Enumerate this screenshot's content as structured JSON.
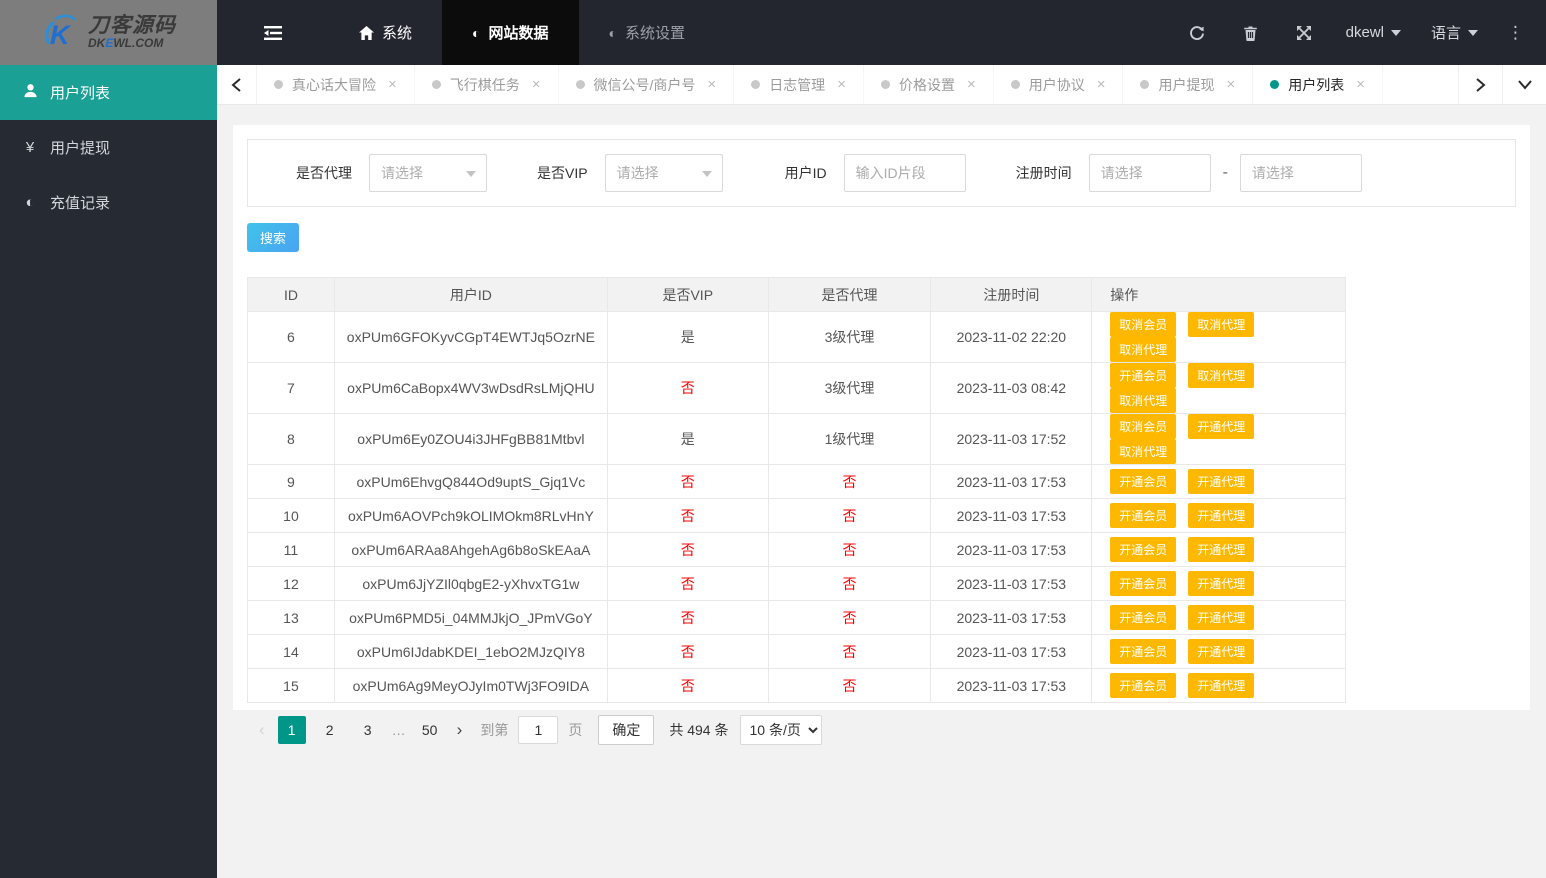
{
  "colors": {
    "accent_teal": "#1aa094",
    "accent_teal_dark": "#009688",
    "action_orange": "#ffb800",
    "negative_red": "#ff0000",
    "search_gradient_start": "#41c3e9",
    "search_gradient_end": "#4aa3f3",
    "header_dark": "#23262e",
    "nav_active_black": "#0c0c0c",
    "sidebar_dark": "#262b33",
    "logo_gray": "#7d7d7d"
  },
  "header": {
    "logo_title": "刀客源码",
    "logo_subtitle_pre": "DK",
    "logo_subtitle_mid": "E",
    "logo_subtitle_post": "WL.COM",
    "nav": [
      {
        "label": "系统",
        "icon": "home-icon",
        "active": false
      },
      {
        "label": "网站数据",
        "icon": "half-circle-icon",
        "active": true
      },
      {
        "label": "系统设置",
        "icon": "half-circle-icon",
        "active": false
      }
    ],
    "username": "dkewl",
    "language": "语言"
  },
  "sidebar": {
    "items": [
      {
        "label": "用户列表",
        "icon": "user-icon",
        "active": true
      },
      {
        "label": "用户提现",
        "icon": "yen-icon",
        "active": false
      },
      {
        "label": "充值记录",
        "icon": "half-circle-icon",
        "active": false
      }
    ]
  },
  "tabs": [
    {
      "label": "真心话大冒险",
      "active": false
    },
    {
      "label": "飞行棋任务",
      "active": false
    },
    {
      "label": "微信公号/商户号",
      "active": false
    },
    {
      "label": "日志管理",
      "active": false
    },
    {
      "label": "价格设置",
      "active": false
    },
    {
      "label": "用户协议",
      "active": false
    },
    {
      "label": "用户提现",
      "active": false
    },
    {
      "label": "用户列表",
      "active": true
    }
  ],
  "filters": {
    "agent_label": "是否代理",
    "agent_placeholder": "请选择",
    "vip_label": "是否VIP",
    "vip_placeholder": "请选择",
    "user_id_label": "用户ID",
    "user_id_placeholder": "输入ID片段",
    "reg_time_label": "注册时间",
    "reg_start_placeholder": "请选择",
    "reg_end_placeholder": "请选择",
    "range_separator": "-"
  },
  "search_button": "搜索",
  "table": {
    "columns": [
      "ID",
      "用户ID",
      "是否VIP",
      "是否代理",
      "注册时间",
      "操作"
    ],
    "rows": [
      {
        "id": "6",
        "user_id": "oxPUm6GFOKyvCGpT4EWTJq5OzrNE",
        "vip": "是",
        "vip_red": false,
        "agent": "3级代理",
        "agent_red": false,
        "reg_time": "2023-11-02 22:20",
        "actions": [
          "取消会员",
          "取消代理",
          "取消代理"
        ]
      },
      {
        "id": "7",
        "user_id": "oxPUm6CaBopx4WV3wDsdRsLMjQHU",
        "vip": "否",
        "vip_red": true,
        "agent": "3级代理",
        "agent_red": false,
        "reg_time": "2023-11-03 08:42",
        "actions": [
          "开通会员",
          "取消代理",
          "取消代理"
        ]
      },
      {
        "id": "8",
        "user_id": "oxPUm6Ey0ZOU4i3JHFgBB81Mtbvl",
        "vip": "是",
        "vip_red": false,
        "agent": "1级代理",
        "agent_red": false,
        "reg_time": "2023-11-03 17:52",
        "actions": [
          "取消会员",
          "开通代理",
          "取消代理"
        ]
      },
      {
        "id": "9",
        "user_id": "oxPUm6EhvgQ844Od9uptS_Gjq1Vc",
        "vip": "否",
        "vip_red": true,
        "agent": "否",
        "agent_red": true,
        "reg_time": "2023-11-03 17:53",
        "actions": [
          "开通会员",
          "开通代理"
        ]
      },
      {
        "id": "10",
        "user_id": "oxPUm6AOVPch9kOLIMOkm8RLvHnY",
        "vip": "否",
        "vip_red": true,
        "agent": "否",
        "agent_red": true,
        "reg_time": "2023-11-03 17:53",
        "actions": [
          "开通会员",
          "开通代理"
        ]
      },
      {
        "id": "11",
        "user_id": "oxPUm6ARAa8AhgehAg6b8oSkEAaA",
        "vip": "否",
        "vip_red": true,
        "agent": "否",
        "agent_red": true,
        "reg_time": "2023-11-03 17:53",
        "actions": [
          "开通会员",
          "开通代理"
        ]
      },
      {
        "id": "12",
        "user_id": "oxPUm6JjYZIl0qbgE2-yXhvxTG1w",
        "vip": "否",
        "vip_red": true,
        "agent": "否",
        "agent_red": true,
        "reg_time": "2023-11-03 17:53",
        "actions": [
          "开通会员",
          "开通代理"
        ]
      },
      {
        "id": "13",
        "user_id": "oxPUm6PMD5i_04MMJkjO_JPmVGoY",
        "vip": "否",
        "vip_red": true,
        "agent": "否",
        "agent_red": true,
        "reg_time": "2023-11-03 17:53",
        "actions": [
          "开通会员",
          "开通代理"
        ]
      },
      {
        "id": "14",
        "user_id": "oxPUm6IJdabKDEI_1ebO2MJzQIY8",
        "vip": "否",
        "vip_red": true,
        "agent": "否",
        "agent_red": true,
        "reg_time": "2023-11-03 17:53",
        "actions": [
          "开通会员",
          "开通代理"
        ]
      },
      {
        "id": "15",
        "user_id": "oxPUm6Ag9MeyOJyIm0TWj3FO9IDA",
        "vip": "否",
        "vip_red": true,
        "agent": "否",
        "agent_red": true,
        "reg_time": "2023-11-03 17:53",
        "actions": [
          "开通会员",
          "开通代理"
        ]
      }
    ]
  },
  "pagination": {
    "pages": [
      "1",
      "2",
      "3",
      "…",
      "50"
    ],
    "active_page": "1",
    "jump_prefix": "到第",
    "jump_value": "1",
    "jump_suffix": "页",
    "confirm_label": "确定",
    "total_text": "共 494 条",
    "page_size_option": "10 条/页"
  }
}
